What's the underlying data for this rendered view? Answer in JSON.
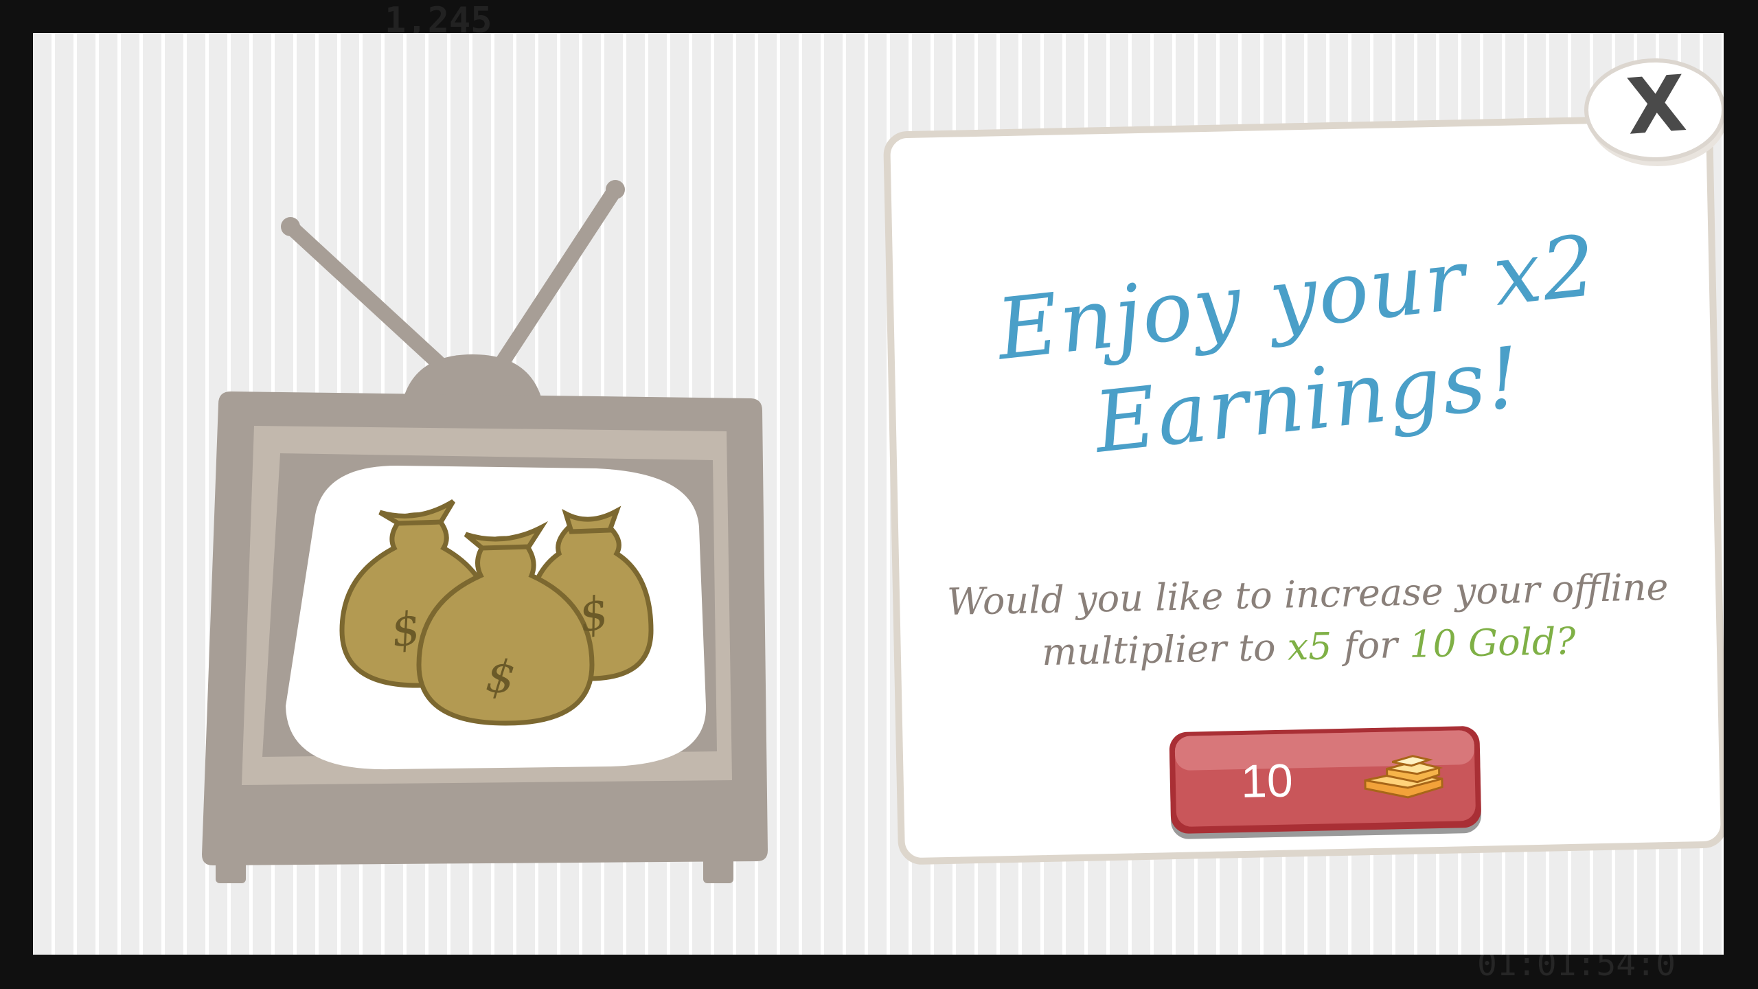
{
  "background": {
    "counter_text": "1,245",
    "timer_text": "01:01:54:0"
  },
  "modal": {
    "close_label": "X",
    "title_line1": "Enjoy your x2",
    "title_line2": "Earnings!",
    "body_prefix": "Would you like to increase your offline multiplier to",
    "multiplier": "x5",
    "body_mid": "for",
    "gold_offer": "10 Gold?",
    "buy_amount": "10"
  },
  "icons": {
    "tv": "retro-tv-icon",
    "money_bags": "money-bags-icon",
    "gold": "gold-bars-icon",
    "close": "close-icon"
  },
  "colors": {
    "title_blue": "#4a9fc8",
    "highlight_green": "#7fb046",
    "body_gray": "#8a807a",
    "button_red": "#c4484b",
    "tv_gray": "#a79e96"
  }
}
